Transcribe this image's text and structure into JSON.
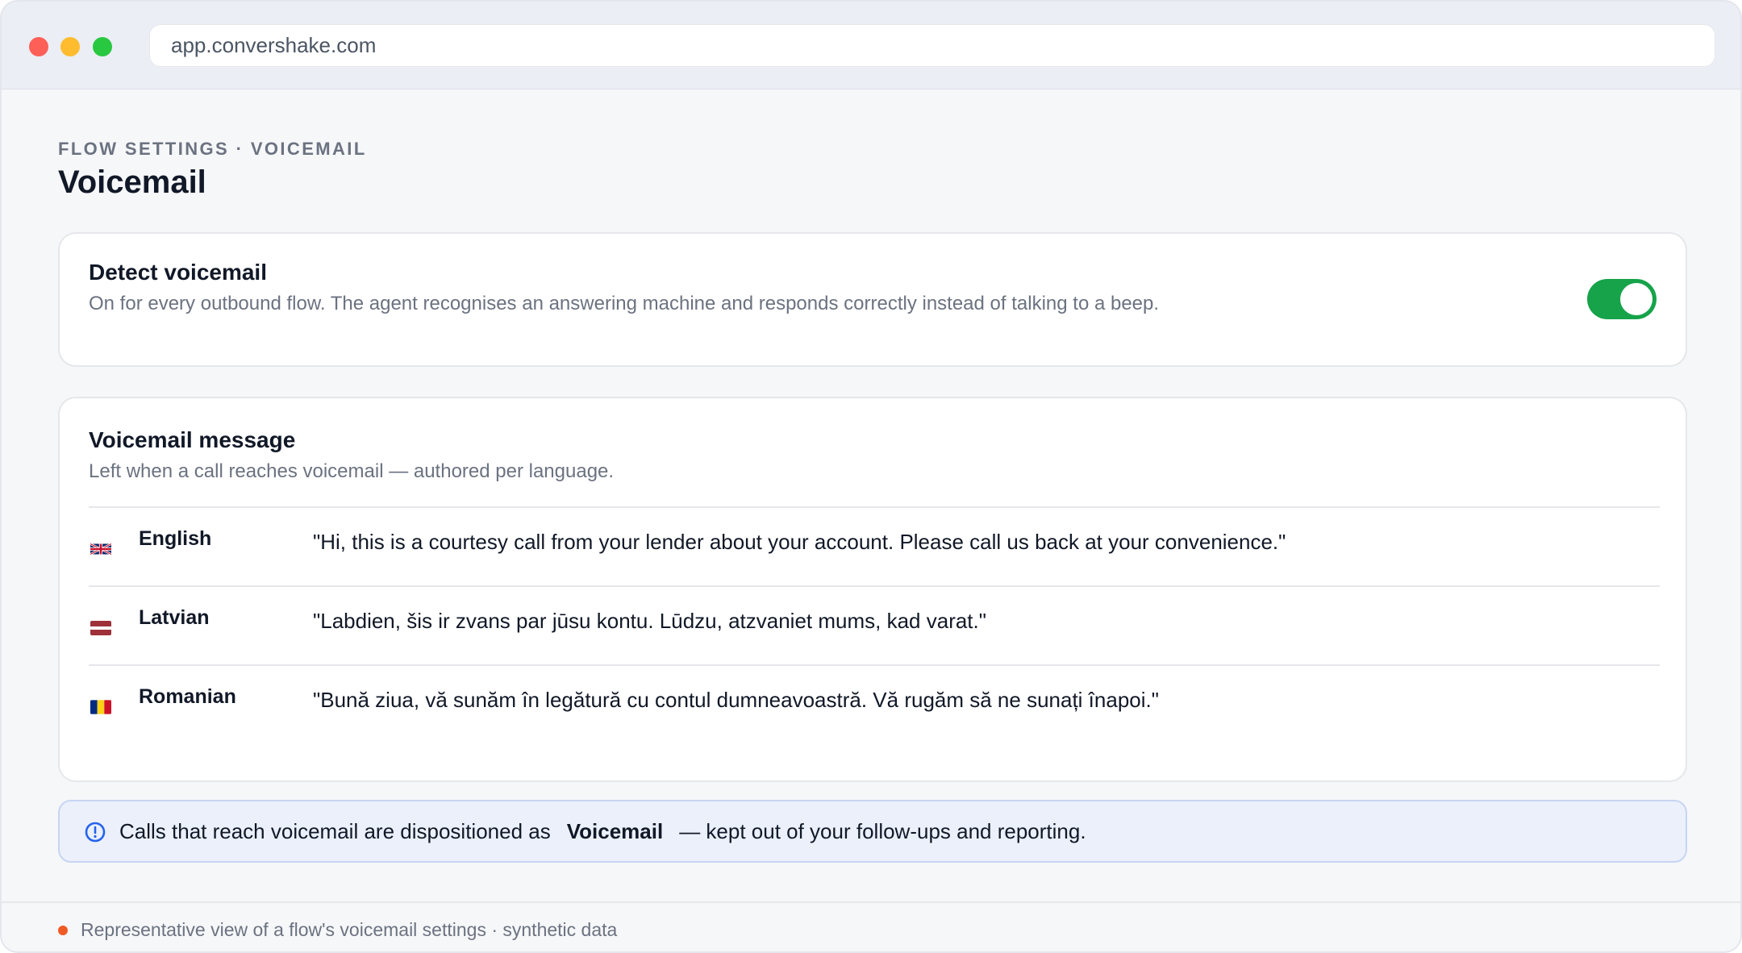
{
  "browser": {
    "url": "app.convershake.com"
  },
  "header": {
    "breadcrumb": "FLOW SETTINGS · VOICEMAIL",
    "title": "Voicemail"
  },
  "detect_card": {
    "title": "Detect voicemail",
    "description": "On for every outbound flow. The agent recognises an answering machine and responds correctly instead of talking to a beep.",
    "toggle_on": true,
    "toggle_color": "#16a34a"
  },
  "message_card": {
    "title": "Voicemail message",
    "description": "Left when a call reaches voicemail — authored per language.",
    "languages": [
      {
        "flag": "uk-flag-icon",
        "name": "English",
        "message": "\"Hi, this is a courtesy call from your lender about your account. Please call us back at your convenience.\""
      },
      {
        "flag": "latvia-flag-icon",
        "name": "Latvian",
        "message": "\"Labdien, šis ir zvans par jūsu kontu. Lūdzu, atzvaniet mums, kad varat.\""
      },
      {
        "flag": "romania-flag-icon",
        "name": "Romanian",
        "message": "\"Bună ziua, vă sunăm în legătură cu contul dumneavoastră. Vă rugăm să ne sunați înapoi.\""
      }
    ]
  },
  "notice": {
    "icon": "info-icon",
    "prefix": "Calls that reach voicemail are dispositioned as",
    "highlight": "Voicemail",
    "suffix": "— kept out of your follow-ups and reporting."
  },
  "footer": {
    "text": "Representative view of a flow's voicemail settings · synthetic data",
    "dot_color": "#f05a24"
  }
}
